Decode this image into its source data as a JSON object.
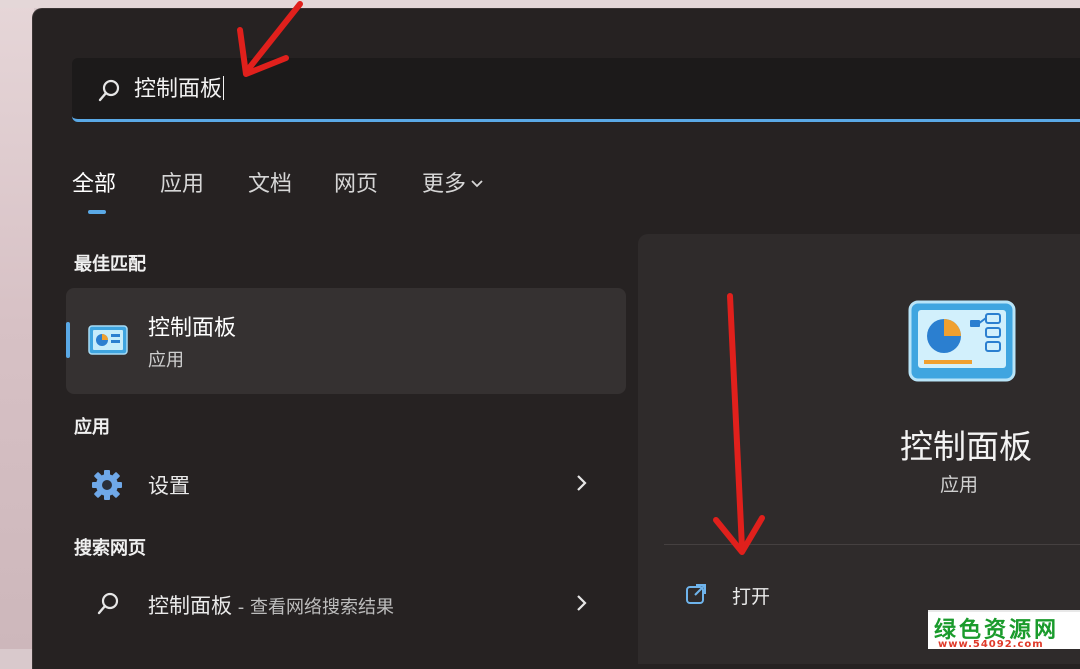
{
  "search": {
    "query": "控制面板"
  },
  "tabs": [
    {
      "label": "全部",
      "active": true
    },
    {
      "label": "应用"
    },
    {
      "label": "文档"
    },
    {
      "label": "网页"
    },
    {
      "label": "更多"
    }
  ],
  "sections": {
    "best_match": "最佳匹配",
    "apps": "应用",
    "web": "搜索网页"
  },
  "best_match": {
    "title": "控制面板",
    "subtitle": "应用",
    "icon": "control-panel-icon"
  },
  "apps": [
    {
      "label": "设置",
      "icon": "gear-icon"
    }
  ],
  "web": [
    {
      "label": "控制面板",
      "suffix": " - 查看网络搜索结果",
      "icon": "search-icon"
    }
  ],
  "detail": {
    "title": "控制面板",
    "subtitle": "应用",
    "actions": [
      {
        "label": "打开",
        "icon": "open-external-icon"
      }
    ]
  },
  "watermark": {
    "title": "绿色资源网",
    "url": "www.54092.com"
  },
  "colors": {
    "accent": "#5aa9e6",
    "panel_bg": "#262222",
    "annotation_arrow": "#e0201c",
    "watermark_green": "#1a9b2c",
    "watermark_red": "#e03a2a"
  }
}
